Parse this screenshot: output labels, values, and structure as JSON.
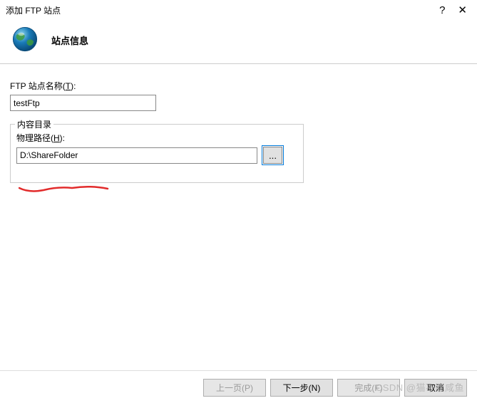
{
  "titlebar": {
    "title": "添加 FTP 站点",
    "help": "?",
    "close": "✕"
  },
  "header": {
    "title": "站点信息"
  },
  "form": {
    "site_name_label_prefix": "FTP 站点名称(",
    "site_name_label_key": "T",
    "site_name_label_suffix": "):",
    "site_name_value": "testFtp"
  },
  "fieldset": {
    "legend": "内容目录",
    "path_label_prefix": "物理路径(",
    "path_label_key": "H",
    "path_label_suffix": "):",
    "path_value": "D:\\ShareFolder",
    "browse_label": "..."
  },
  "buttons": {
    "prev": "上一页(P)",
    "next": "下一步(N)",
    "finish": "完成(F)",
    "cancel": "取消"
  },
  "watermark": "CSDN @猫不吃咸鱼"
}
